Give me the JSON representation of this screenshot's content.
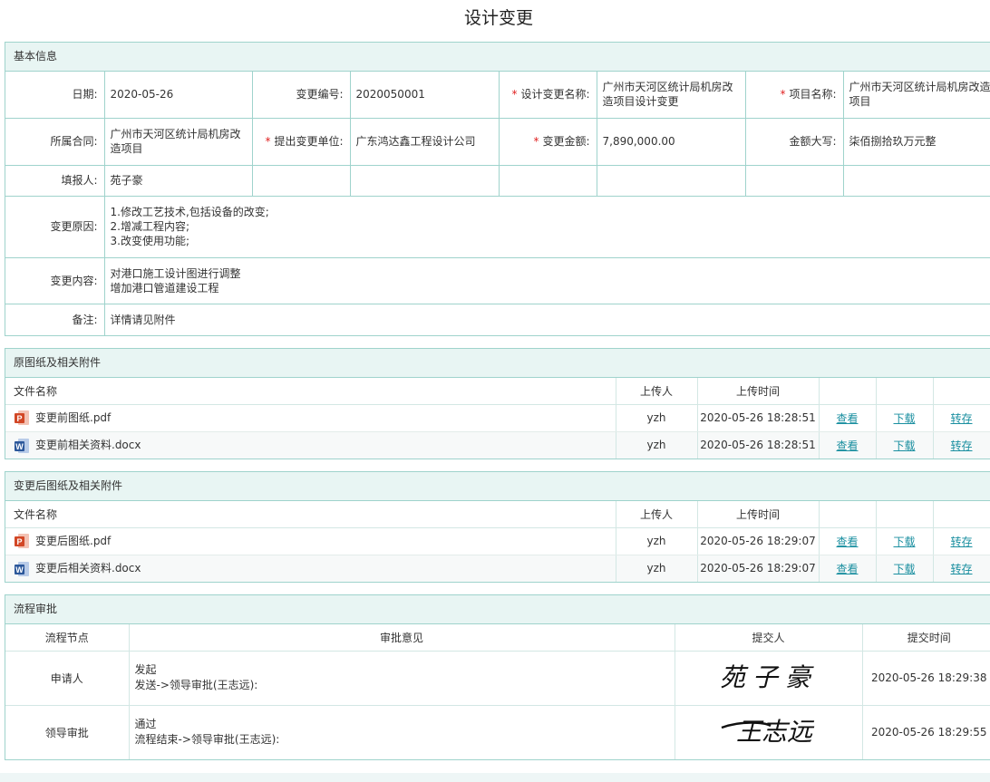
{
  "title": "设计变更",
  "basic": {
    "header": "基本信息",
    "date_label": "日期:",
    "date": "2020-05-26",
    "change_no_label": "变更编号:",
    "change_no": "2020050001",
    "change_name_label": "设计变更名称:",
    "change_name": "广州市天河区统计局机房改造项目设计变更",
    "project_label": "项目名称:",
    "project": "广州市天河区统计局机房改造项目",
    "contract_label": "所属合同:",
    "contract": "广州市天河区统计局机房改造项目",
    "unit_label": "提出变更单位:",
    "unit": "广东鸿达鑫工程设计公司",
    "amount_label": "变更金额:",
    "amount": "7,890,000.00",
    "amount_cn_label": "金额大写:",
    "amount_cn": "柒佰捌拾玖万元整",
    "filler_label": "填报人:",
    "filler": "苑子豪",
    "reason_label": "变更原因:",
    "reason_lines": [
      "1.修改工艺技术,包括设备的改变;",
      "2.增减工程内容;",
      "3.改变使用功能;"
    ],
    "content_label": "变更内容:",
    "content_lines": [
      "对港口施工设计图进行调整",
      "增加港口管道建设工程"
    ],
    "remark_label": "备注:",
    "remark": "详情请见附件",
    "required_mark": "*"
  },
  "original_files": {
    "header": "原图纸及相关附件",
    "col_name": "文件名称",
    "col_uploader": "上传人",
    "col_time": "上传时间",
    "rows": [
      {
        "name": "变更前图纸.pdf",
        "icon": "pdf-file-icon",
        "uploader": "yzh",
        "time": "2020-05-26 18:28:51",
        "view": "查看",
        "download": "下载",
        "transfer": "转存"
      },
      {
        "name": "变更前相关资料.docx",
        "icon": "word-file-icon",
        "uploader": "yzh",
        "time": "2020-05-26 18:28:51",
        "view": "查看",
        "download": "下载",
        "transfer": "转存"
      }
    ]
  },
  "changed_files": {
    "header": "变更后图纸及相关附件",
    "col_name": "文件名称",
    "col_uploader": "上传人",
    "col_time": "上传时间",
    "rows": [
      {
        "name": "变更后图纸.pdf",
        "icon": "pdf-file-icon",
        "uploader": "yzh",
        "time": "2020-05-26 18:29:07",
        "view": "查看",
        "download": "下载",
        "transfer": "转存"
      },
      {
        "name": "变更后相关资料.docx",
        "icon": "word-file-icon",
        "uploader": "yzh",
        "time": "2020-05-26 18:29:07",
        "view": "查看",
        "download": "下载",
        "transfer": "转存"
      }
    ]
  },
  "flow": {
    "header": "流程审批",
    "col_node": "流程节点",
    "col_opinion": "审批意见",
    "col_submitter": "提交人",
    "col_time": "提交时间",
    "rows": [
      {
        "node": "申请人",
        "opinion1": "发起",
        "opinion2": "发送->领导审批(王志远):",
        "signature": "苑子豪",
        "time": "2020-05-26 18:29:38"
      },
      {
        "node": "领导审批",
        "opinion1": "通过",
        "opinion2": "流程结束->领导审批(王志远):",
        "signature": "王志远",
        "time": "2020-05-26 18:29:55"
      }
    ]
  },
  "colors": {
    "accent": "#1a8fa0",
    "border": "#9fd3cc",
    "header_bg": "#e8f5f3",
    "required": "#e02020",
    "pdf": "#d24726",
    "word": "#2b579a"
  }
}
